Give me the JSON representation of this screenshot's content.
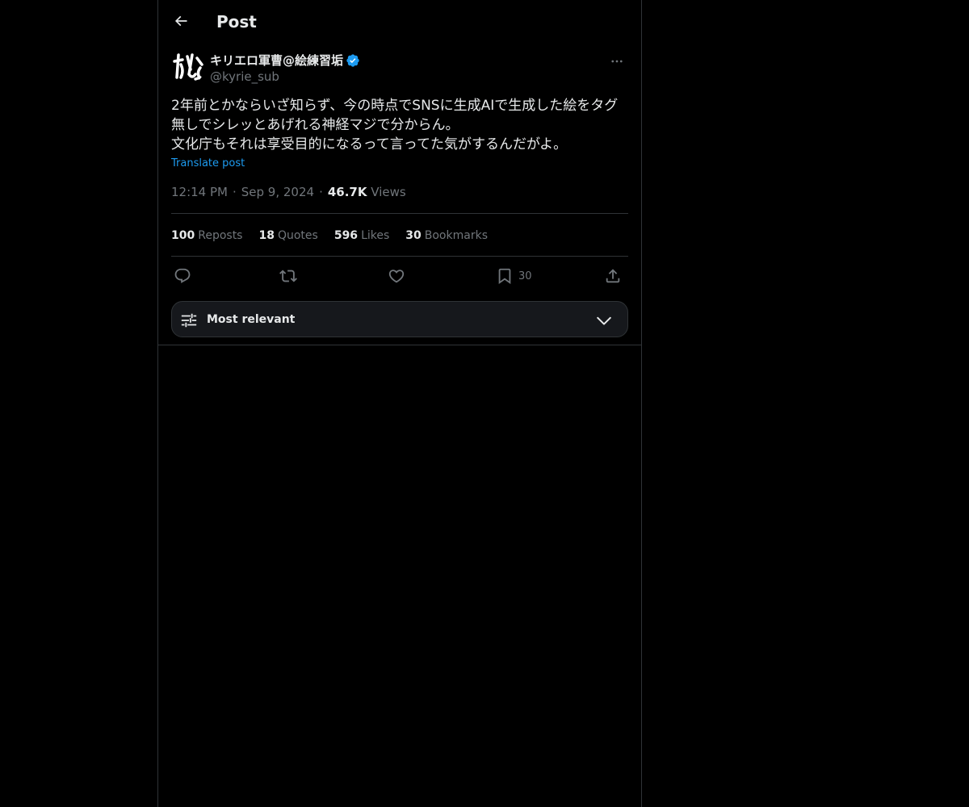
{
  "header": {
    "title": "Post",
    "back_icon": "arrow-left-icon"
  },
  "author": {
    "display_name": "キリエロ軍曹@絵練習垢",
    "handle": "@kyrie_sub",
    "verified": true,
    "verified_color": "#1d9bf0"
  },
  "post": {
    "text": "2年前とかならいざ知らず、今の時点でSNSに生成AIで生成した絵をタグ無しでシレッとあげれる神経マジで分からん。\n文化庁もそれは享受目的になるって言ってた気がするんだがよ。",
    "translate_label": "Translate post",
    "time": "12:14 PM",
    "date": "Sep 9, 2024",
    "views_count": "46.7K",
    "views_label": "Views"
  },
  "stats": {
    "reposts": {
      "count": "100",
      "label": "Reposts"
    },
    "quotes": {
      "count": "18",
      "label": "Quotes"
    },
    "likes": {
      "count": "596",
      "label": "Likes"
    },
    "bookmarks": {
      "count": "30",
      "label": "Bookmarks"
    }
  },
  "actions": {
    "reply_icon": "reply-icon",
    "repost_icon": "repost-icon",
    "like_icon": "heart-icon",
    "bookmark_icon": "bookmark-icon",
    "bookmark_count": "30",
    "share_icon": "share-icon"
  },
  "replies_sort": {
    "label": "Most relevant",
    "icon": "sliders-icon"
  },
  "colors": {
    "background": "#000000",
    "text_primary": "#e7e9ea",
    "text_secondary": "#71767b",
    "accent": "#1d9bf0",
    "border": "#2f3336"
  }
}
